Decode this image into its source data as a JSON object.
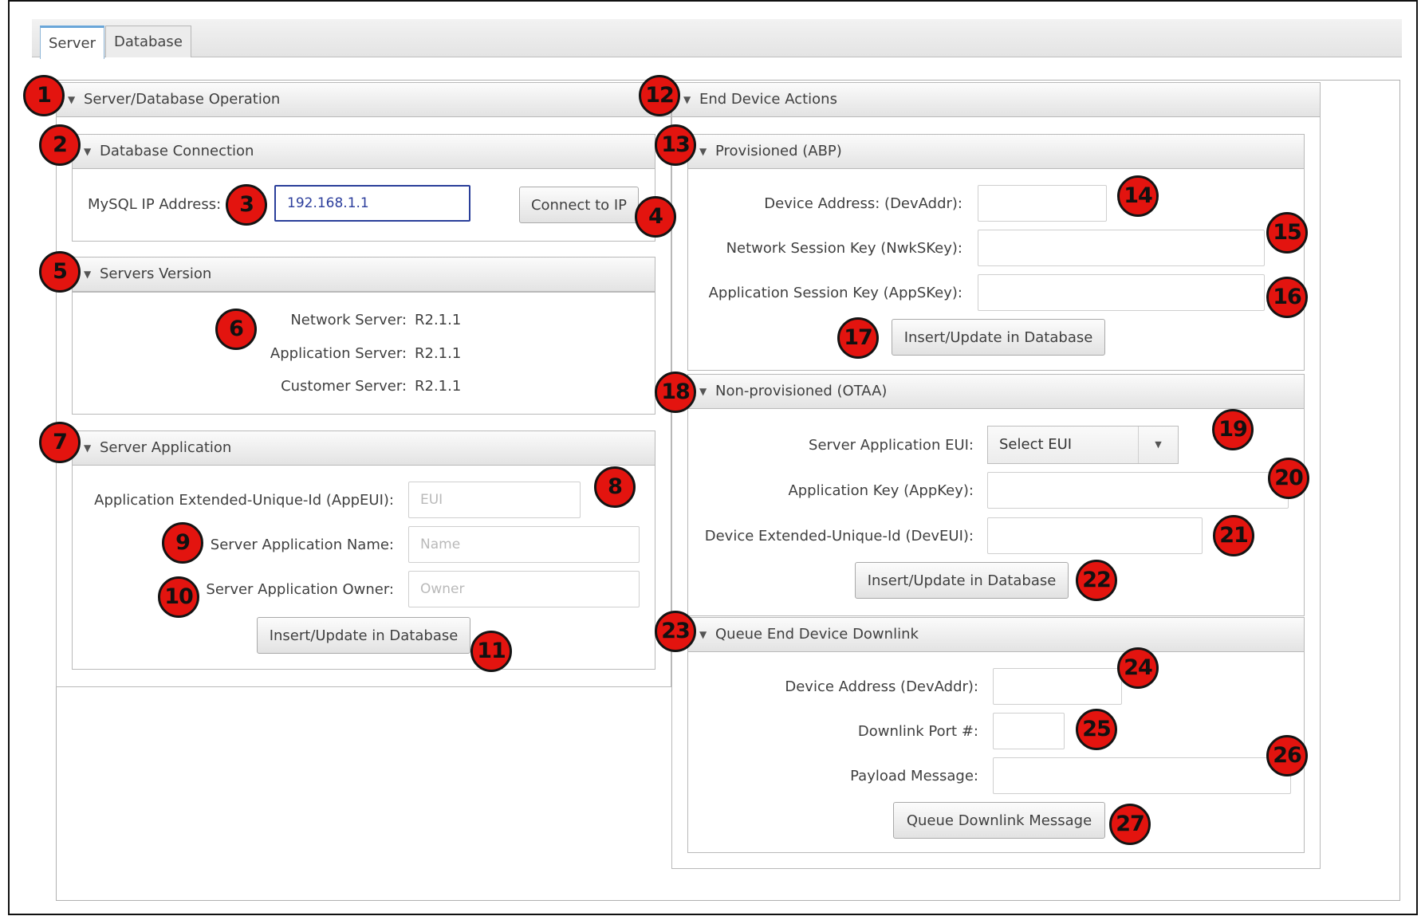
{
  "tabs": [
    "Server",
    "Database"
  ],
  "sections": {
    "server_db_operation": "Server/Database Operation",
    "database_connection": "Database Connection",
    "servers_version": "Servers Version",
    "server_application": "Server Application",
    "end_device_actions": "End Device Actions",
    "provisioned": "Provisioned (ABP)",
    "non_provisioned": "Non-provisioned (OTAA)",
    "queue_downlink": "Queue End Device Downlink"
  },
  "db_connection": {
    "mysql_label": "MySQL IP Address:",
    "mysql_value": "192.168.1.1",
    "connect_button": "Connect to IP"
  },
  "versions": [
    {
      "label": "Network Server:",
      "value": "R2.1.1"
    },
    {
      "label": "Application Server:",
      "value": "R2.1.1"
    },
    {
      "label": "Customer Server:",
      "value": "R2.1.1"
    }
  ],
  "server_app": {
    "appeui_label": "Application Extended-Unique-Id (AppEUI):",
    "appeui_placeholder": "EUI",
    "name_label": "Server Application Name:",
    "name_placeholder": "Name",
    "owner_label": "Server Application Owner:",
    "owner_placeholder": "Owner",
    "insert_button": "Insert/Update in Database"
  },
  "abp": {
    "devaddr_label": "Device Address: (DevAddr):",
    "nwkskey_label": "Network Session Key (NwkSKey):",
    "appskey_label": "Application Session Key (AppSKey):",
    "insert_button": "Insert/Update in Database"
  },
  "otaa": {
    "eui_label": "Server Application EUI:",
    "eui_selected": "Select EUI",
    "appkey_label": "Application Key (AppKey):",
    "deveui_label": "Device Extended-Unique-Id (DevEUI):",
    "insert_button": "Insert/Update in Database"
  },
  "downlink": {
    "devaddr_label": "Device Address (DevAddr):",
    "port_label": "Downlink Port #:",
    "payload_label": "Payload Message:",
    "queue_button": "Queue Downlink Message"
  },
  "markers": [
    "1",
    "2",
    "3",
    "4",
    "5",
    "6",
    "7",
    "8",
    "9",
    "10",
    "11",
    "12",
    "13",
    "14",
    "15",
    "16",
    "17",
    "18",
    "19",
    "20",
    "21",
    "22",
    "23",
    "24",
    "25",
    "26",
    "27"
  ],
  "colors": {
    "marker_fill": "#e3140f",
    "input_focus_border": "#2a3f9a",
    "tab_active_accent": "#6aa6d9"
  }
}
